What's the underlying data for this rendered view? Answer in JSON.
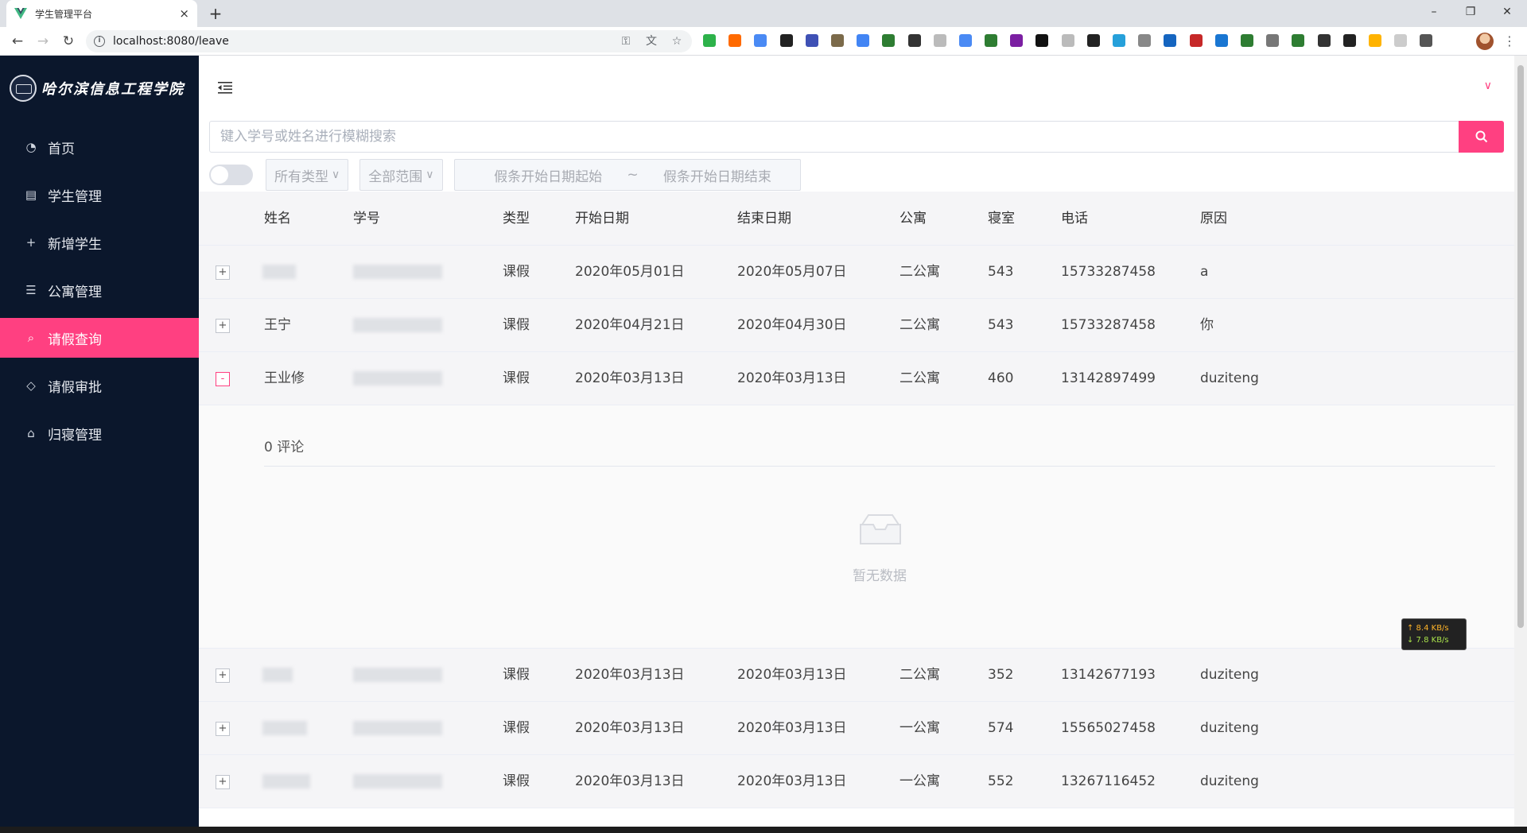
{
  "browser": {
    "tab_title": "学生管理平台",
    "tab_close": "×",
    "new_tab": "+",
    "url": "localhost:8080/leave",
    "window_controls": [
      "–",
      "❐",
      "✕"
    ],
    "extension_colors": [
      "#2db24a",
      "#ff6a00",
      "#4a8af4",
      "#222222",
      "#3f51b5",
      "#7b6a4a",
      "#4285f4",
      "#2e7d32",
      "#333333",
      "#bbbbbb",
      "#4a8af4",
      "#2e7d32",
      "#7b1fa2",
      "#111111",
      "#bbbbbb",
      "#222222",
      "#26a0da",
      "#888888",
      "#1565c0",
      "#c62828",
      "#1976d2",
      "#2e7d32",
      "#777777",
      "#2e7d32",
      "#333333",
      "#222222",
      "#ffb300",
      "#cccccc",
      "#555555"
    ]
  },
  "sidebar": {
    "logo_text": "哈尔滨信息工程学院",
    "items": [
      {
        "label": "首页",
        "icon": "◔"
      },
      {
        "label": "学生管理",
        "icon": "▤"
      },
      {
        "label": "新增学生",
        "icon": "+"
      },
      {
        "label": "公寓管理",
        "icon": "☰"
      },
      {
        "label": "请假查询",
        "icon": "⌕"
      },
      {
        "label": "请假审批",
        "icon": "◇"
      },
      {
        "label": "归寝管理",
        "icon": "⌂"
      }
    ]
  },
  "search": {
    "placeholder": "键入学号或姓名进行模糊搜索"
  },
  "filters": {
    "type_select": "所有类型",
    "scope_select": "全部范围",
    "arrow": "∨",
    "date_start_placeholder": "假条开始日期起始",
    "date_separator": "~",
    "date_end_placeholder": "假条开始日期结束"
  },
  "table": {
    "columns": [
      "姓名",
      "学号",
      "类型",
      "开始日期",
      "结束日期",
      "公寓",
      "寝室",
      "电话",
      "原因"
    ],
    "rows": [
      {
        "expand": "+",
        "name": "",
        "student_id": "",
        "type": "课假",
        "start": "2020年05月01日",
        "end": "2020年05月07日",
        "dorm": "二公寓",
        "room": "543",
        "phone": "15733287458",
        "reason": "a"
      },
      {
        "expand": "+",
        "name": "王宁",
        "student_id": "",
        "type": "课假",
        "start": "2020年04月21日",
        "end": "2020年04月30日",
        "dorm": "二公寓",
        "room": "543",
        "phone": "15733287458",
        "reason": "你"
      },
      {
        "expand": "-",
        "name": "王业修",
        "student_id": "",
        "type": "课假",
        "start": "2020年03月13日",
        "end": "2020年03月13日",
        "dorm": "二公寓",
        "room": "460",
        "phone": "13142897499",
        "reason": "duziteng"
      },
      {
        "expand": "+",
        "name": "",
        "student_id": "",
        "type": "课假",
        "start": "2020年03月13日",
        "end": "2020年03月13日",
        "dorm": "二公寓",
        "room": "352",
        "phone": "13142677193",
        "reason": "duziteng"
      },
      {
        "expand": "+",
        "name": "",
        "student_id": "",
        "type": "课假",
        "start": "2020年03月13日",
        "end": "2020年03月13日",
        "dorm": "一公寓",
        "room": "574",
        "phone": "15565027458",
        "reason": "duziteng"
      },
      {
        "expand": "+",
        "name": "",
        "student_id": "",
        "type": "课假",
        "start": "2020年03月13日",
        "end": "2020年03月13日",
        "dorm": "一公寓",
        "room": "552",
        "phone": "13267116452",
        "reason": "duziteng"
      }
    ],
    "expanded": {
      "comment_count": "0 评论",
      "empty_text": "暂无数据"
    }
  },
  "speed_widget": {
    "up": "↑ 8.4 KB/s",
    "down": "↓ 7.8 KB/s"
  },
  "colors": {
    "accent": "#ff4081",
    "sidebar_bg": "#0b172c"
  }
}
